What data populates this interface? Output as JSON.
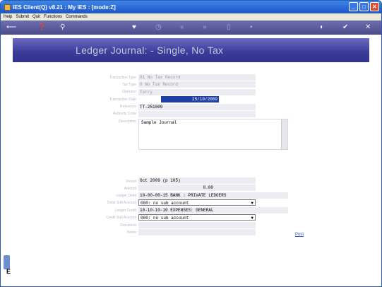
{
  "window": {
    "title": "IES Client(Q) v8.21 : My IES :     [mode:Z]",
    "controls": [
      "min",
      "max",
      "close"
    ]
  },
  "menu": [
    "Help",
    "Submit",
    "Quit",
    "Functions",
    "Commands"
  ],
  "toolbar": {
    "icons": [
      "back-arrow-icon",
      "info-icon",
      "search-icon",
      "heart-icon",
      "clock-icon",
      "rewind-icon",
      "fast-forward-icon",
      "paste-icon",
      "save-icon",
      "globe-icon",
      "check-icon",
      "close-icon"
    ]
  },
  "page": {
    "title": "Ledger Journal: -    Single, No Tax"
  },
  "form": {
    "labels": {
      "transaction_type": "Transaction Type",
      "tax_type": "Tax Type",
      "operator": "Operator",
      "transaction_date": "Transaction Date",
      "reference": "Reference",
      "authority_code": "Authority Code",
      "description": "Description",
      "period": "Period",
      "amount": "Amount",
      "ledger_debit": "Ledger Debit",
      "debit_sub_account": "Debit Sub Account",
      "ledger_credit": "Ledger Credit",
      "credit_sub_account": "Credit Sub Account",
      "document": "Document",
      "notes": "Notes"
    },
    "values": {
      "transaction_type": "01 No Tax Record",
      "tax_type": "0 No Tax Record",
      "operator": "Terry",
      "transaction_date": "25/10/2009",
      "reference": "TT-251009",
      "authority_code": "",
      "description": "Sample Journal",
      "period": "Oct 2009 (p 105)",
      "amount": "0.00",
      "ledger_debit": "10-00-00-15 BANK : PRIVATE LEDGERS",
      "debit_sub_account": "000: no sub account",
      "ledger_credit": "10-10-10-10 EXPENSES: GENERAL",
      "credit_sub_account": "000: no sub account",
      "document": "",
      "notes": ""
    }
  },
  "actions": {
    "post": "Post"
  },
  "side": {
    "label": "E"
  }
}
